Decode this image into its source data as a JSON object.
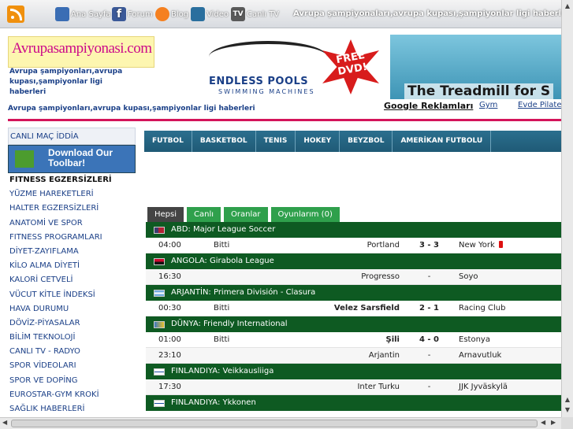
{
  "topnav": {
    "items": [
      {
        "label": "Ana Sayfa",
        "icon": "house-icon"
      },
      {
        "label": "Forum",
        "icon": "facebook-icon"
      },
      {
        "label": "Blog",
        "icon": "blog-icon"
      },
      {
        "label": "Video",
        "icon": "video-icon"
      },
      {
        "label": "Canlı TV",
        "icon": "tv-icon"
      }
    ],
    "headline": "Avrupa şampiyonaları,avrupa kupası,şampiyonlar ligi haberleri"
  },
  "header": {
    "logo_text": "Avrupasampiyonasi.com",
    "logo_desc": "Avrupa şampiyonları,avrupa kupası,şampiyonlar ligi haberleri",
    "subheadline": "Avrupa şampiyonları,avrupa kupası,şampiyonlar ligi haberleri"
  },
  "banner": {
    "brand": "ENDLESS POOLS",
    "sub": "SWIMMING MACHINES",
    "free": "FREE DVD!",
    "tagline": "The Treadmill for S"
  },
  "ads": {
    "google": "Google Reklamları",
    "gym": "Gym",
    "pilates": "Evde Pilates"
  },
  "sidebar": {
    "canli_iddia": "CANLI MAÇ İDDİA",
    "toolbar": "Download Our Toolbar!",
    "items": [
      "FITNESS EGZERSİZLERİ",
      "YÜZME HAREKETLERİ",
      "HALTER EGZERSİZLERİ",
      "ANATOMİ VE SPOR",
      "FITNESS PROGRAMLARI",
      "DİYET-ZAYIFLAMA",
      "KİLO ALMA DİYETİ",
      "KALORİ CETVELİ",
      "VÜCUT KİTLE İNDEKSİ",
      "HAVA DURUMU",
      "DÖVİZ-PİYASALAR",
      "BİLİM TEKNOLOJİ",
      "CANLI TV - RADYO",
      "SPOR VİDEOLARI",
      "SPOR VE DOPİNG",
      "EUROSTAR-GYM KROKİ",
      "SAĞLIK HABERLERİ"
    ]
  },
  "sport_tabs": [
    "FUTBOL",
    "BASKETBOL",
    "TENIS",
    "HOKEY",
    "BEYZBOL",
    "AMERİKAN FUTBOLU"
  ],
  "filter_tabs": [
    {
      "label": "Hepsi",
      "active": true
    },
    {
      "label": "Canlı",
      "active": false
    },
    {
      "label": "Oranlar",
      "active": false
    },
    {
      "label": "Oyunlarım (0)",
      "active": false
    }
  ],
  "leagues": [
    {
      "name": "ABD: Major League Soccer",
      "flag": "usa",
      "matches": [
        {
          "time": "04:00",
          "status": "Bitti",
          "home": "Portland",
          "score": "3 - 3",
          "away": "New York",
          "red_card": true
        }
      ]
    },
    {
      "name": "ANGOLA: Girabola League",
      "flag": "angola",
      "matches": [
        {
          "time": "16:30",
          "status": "",
          "home": "Progresso",
          "score": "-",
          "away": "Soyo"
        }
      ]
    },
    {
      "name": "ARJANTİN: Primera División - Clasura",
      "flag": "argentina",
      "matches": [
        {
          "time": "00:30",
          "status": "Bitti",
          "home": "Velez Sarsfield",
          "home_bold": true,
          "score": "2 - 1",
          "away": "Racing Club"
        }
      ]
    },
    {
      "name": "DÜNYA: Friendly International",
      "flag": "world",
      "matches": [
        {
          "time": "01:00",
          "status": "Bitti",
          "home": "Şili",
          "home_bold": true,
          "score": "4 - 0",
          "away": "Estonya"
        },
        {
          "time": "23:10",
          "status": "",
          "home": "Arjantin",
          "score": "-",
          "away": "Arnavutluk"
        }
      ]
    },
    {
      "name": "FINLANDIYA: Veikkausliiga",
      "flag": "finland",
      "matches": [
        {
          "time": "17:30",
          "status": "",
          "home": "Inter Turku",
          "score": "-",
          "away": "JJK Jyväskylä"
        }
      ]
    },
    {
      "name": "FINLANDIYA: Ykkonen",
      "flag": "finland",
      "matches": []
    }
  ],
  "colors": {
    "league_bar": "#0e5a22",
    "sport_tab": "#1f5a76",
    "filter_active": "#444444",
    "filter_tab": "#2fa04c",
    "pink_rule": "#d4145a",
    "link_blue": "#1a3f87"
  }
}
